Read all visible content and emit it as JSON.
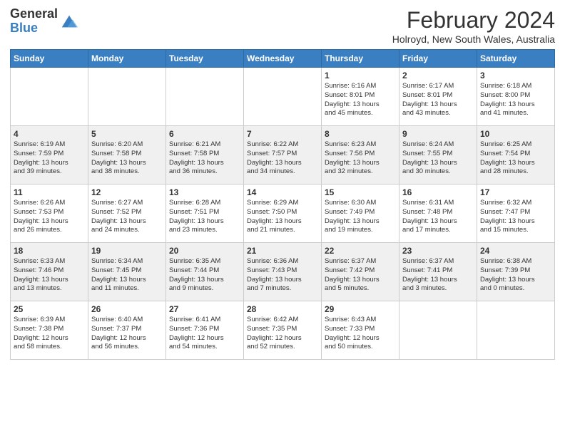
{
  "logo": {
    "line1": "General",
    "line2": "Blue"
  },
  "title": "February 2024",
  "subtitle": "Holroyd, New South Wales, Australia",
  "days_of_week": [
    "Sunday",
    "Monday",
    "Tuesday",
    "Wednesday",
    "Thursday",
    "Friday",
    "Saturday"
  ],
  "weeks": [
    [
      {
        "day": "",
        "info": ""
      },
      {
        "day": "",
        "info": ""
      },
      {
        "day": "",
        "info": ""
      },
      {
        "day": "",
        "info": ""
      },
      {
        "day": "1",
        "info": "Sunrise: 6:16 AM\nSunset: 8:01 PM\nDaylight: 13 hours\nand 45 minutes."
      },
      {
        "day": "2",
        "info": "Sunrise: 6:17 AM\nSunset: 8:01 PM\nDaylight: 13 hours\nand 43 minutes."
      },
      {
        "day": "3",
        "info": "Sunrise: 6:18 AM\nSunset: 8:00 PM\nDaylight: 13 hours\nand 41 minutes."
      }
    ],
    [
      {
        "day": "4",
        "info": "Sunrise: 6:19 AM\nSunset: 7:59 PM\nDaylight: 13 hours\nand 39 minutes."
      },
      {
        "day": "5",
        "info": "Sunrise: 6:20 AM\nSunset: 7:58 PM\nDaylight: 13 hours\nand 38 minutes."
      },
      {
        "day": "6",
        "info": "Sunrise: 6:21 AM\nSunset: 7:58 PM\nDaylight: 13 hours\nand 36 minutes."
      },
      {
        "day": "7",
        "info": "Sunrise: 6:22 AM\nSunset: 7:57 PM\nDaylight: 13 hours\nand 34 minutes."
      },
      {
        "day": "8",
        "info": "Sunrise: 6:23 AM\nSunset: 7:56 PM\nDaylight: 13 hours\nand 32 minutes."
      },
      {
        "day": "9",
        "info": "Sunrise: 6:24 AM\nSunset: 7:55 PM\nDaylight: 13 hours\nand 30 minutes."
      },
      {
        "day": "10",
        "info": "Sunrise: 6:25 AM\nSunset: 7:54 PM\nDaylight: 13 hours\nand 28 minutes."
      }
    ],
    [
      {
        "day": "11",
        "info": "Sunrise: 6:26 AM\nSunset: 7:53 PM\nDaylight: 13 hours\nand 26 minutes."
      },
      {
        "day": "12",
        "info": "Sunrise: 6:27 AM\nSunset: 7:52 PM\nDaylight: 13 hours\nand 24 minutes."
      },
      {
        "day": "13",
        "info": "Sunrise: 6:28 AM\nSunset: 7:51 PM\nDaylight: 13 hours\nand 23 minutes."
      },
      {
        "day": "14",
        "info": "Sunrise: 6:29 AM\nSunset: 7:50 PM\nDaylight: 13 hours\nand 21 minutes."
      },
      {
        "day": "15",
        "info": "Sunrise: 6:30 AM\nSunset: 7:49 PM\nDaylight: 13 hours\nand 19 minutes."
      },
      {
        "day": "16",
        "info": "Sunrise: 6:31 AM\nSunset: 7:48 PM\nDaylight: 13 hours\nand 17 minutes."
      },
      {
        "day": "17",
        "info": "Sunrise: 6:32 AM\nSunset: 7:47 PM\nDaylight: 13 hours\nand 15 minutes."
      }
    ],
    [
      {
        "day": "18",
        "info": "Sunrise: 6:33 AM\nSunset: 7:46 PM\nDaylight: 13 hours\nand 13 minutes."
      },
      {
        "day": "19",
        "info": "Sunrise: 6:34 AM\nSunset: 7:45 PM\nDaylight: 13 hours\nand 11 minutes."
      },
      {
        "day": "20",
        "info": "Sunrise: 6:35 AM\nSunset: 7:44 PM\nDaylight: 13 hours\nand 9 minutes."
      },
      {
        "day": "21",
        "info": "Sunrise: 6:36 AM\nSunset: 7:43 PM\nDaylight: 13 hours\nand 7 minutes."
      },
      {
        "day": "22",
        "info": "Sunrise: 6:37 AM\nSunset: 7:42 PM\nDaylight: 13 hours\nand 5 minutes."
      },
      {
        "day": "23",
        "info": "Sunrise: 6:37 AM\nSunset: 7:41 PM\nDaylight: 13 hours\nand 3 minutes."
      },
      {
        "day": "24",
        "info": "Sunrise: 6:38 AM\nSunset: 7:39 PM\nDaylight: 13 hours\nand 0 minutes."
      }
    ],
    [
      {
        "day": "25",
        "info": "Sunrise: 6:39 AM\nSunset: 7:38 PM\nDaylight: 12 hours\nand 58 minutes."
      },
      {
        "day": "26",
        "info": "Sunrise: 6:40 AM\nSunset: 7:37 PM\nDaylight: 12 hours\nand 56 minutes."
      },
      {
        "day": "27",
        "info": "Sunrise: 6:41 AM\nSunset: 7:36 PM\nDaylight: 12 hours\nand 54 minutes."
      },
      {
        "day": "28",
        "info": "Sunrise: 6:42 AM\nSunset: 7:35 PM\nDaylight: 12 hours\nand 52 minutes."
      },
      {
        "day": "29",
        "info": "Sunrise: 6:43 AM\nSunset: 7:33 PM\nDaylight: 12 hours\nand 50 minutes."
      },
      {
        "day": "",
        "info": ""
      },
      {
        "day": "",
        "info": ""
      }
    ]
  ],
  "colors": {
    "header_bg": "#3a7fc1",
    "header_text": "#ffffff",
    "row_even_bg": "#f0f0f0",
    "row_odd_bg": "#ffffff"
  }
}
